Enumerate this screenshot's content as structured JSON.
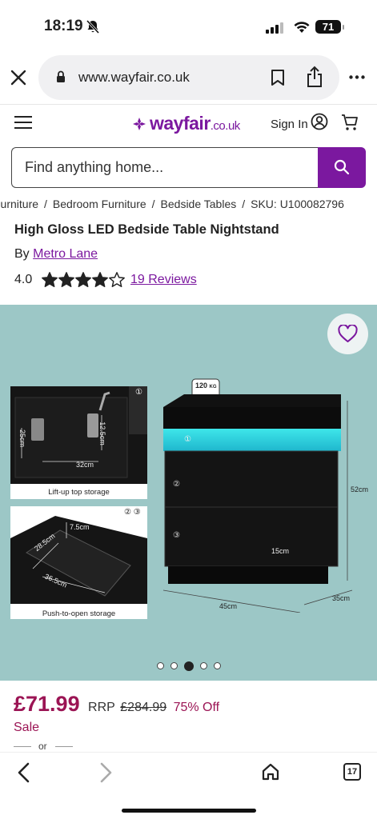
{
  "status_bar": {
    "time": "18:19",
    "battery": "71"
  },
  "browser": {
    "url": "www.wayfair.co.uk",
    "tab_count": "17"
  },
  "header": {
    "logo_main": "wayfair",
    "logo_suffix": ".co.uk",
    "signin": "Sign In"
  },
  "search": {
    "placeholder": "Find anything home..."
  },
  "breadcrumb": {
    "items": [
      "Furniture",
      "Bedroom Furniture",
      "Bedside Tables"
    ],
    "separator": "/",
    "sku": "SKU: U100082796"
  },
  "product": {
    "title": "High Gloss LED Bedside Table Nightstand",
    "by_label": "By",
    "brand": "Metro Lane",
    "rating": "4.0",
    "stars_filled": 4,
    "stars_total": 5,
    "reviews": "19 Reviews"
  },
  "gallery": {
    "panel1_label": "Lift-up top storage",
    "panel2_label": "Push-to-open storage",
    "panel1_dims": {
      "depth": "25cm",
      "width": "32cm",
      "height": "12.5cm",
      "num": "①"
    },
    "panel2_dims": {
      "a": "7.5cm",
      "b": "28.5cm",
      "c": "36.5cm",
      "num": "② ③"
    },
    "main_dims": {
      "height": "52cm",
      "drawer": "15cm",
      "width": "45cm",
      "depth": "35cm",
      "weight": "120",
      "weight_unit": "KG"
    },
    "drawer_nums": [
      "①",
      "②",
      "③"
    ],
    "dots_count": 5,
    "active_dot": 2
  },
  "pricing": {
    "price": "£71.99",
    "rrp_label": "RRP",
    "rrp": "£284.99",
    "discount": "75% Off",
    "sale": "Sale",
    "or": "or"
  },
  "colors": {
    "brand_purple": "#7b189f",
    "price_red": "#9b1454",
    "gallery_bg": "#9cc7c6"
  }
}
